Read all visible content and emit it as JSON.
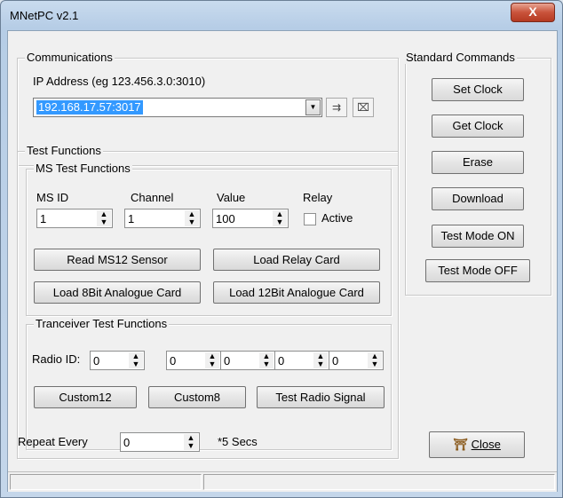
{
  "window": {
    "title": "MNetPC v2.1",
    "close_glyph": "X"
  },
  "communications": {
    "legend": "Communications",
    "ip_label": "IP Address (eg 123.456.3.0:3010)",
    "ip_value": "192.168.17.57:3017"
  },
  "test_functions": {
    "legend": "Test Functions",
    "ms": {
      "legend": "MS Test Functions",
      "ms_id_label": "MS ID",
      "channel_label": "Channel",
      "value_label": "Value",
      "relay_label": "Relay",
      "ms_id": "1",
      "channel": "1",
      "value": "100",
      "active_label": "Active",
      "buttons": {
        "read_ms12": "Read MS12 Sensor",
        "load_relay": "Load Relay Card",
        "load_8bit": "Load 8Bit Analogue Card",
        "load_12bit": "Load 12Bit Analogue Card"
      }
    },
    "tranceiver": {
      "legend": "Tranceiver Test Functions",
      "radio_id_label": "Radio ID:",
      "radio_ids": [
        "0",
        "0",
        "0",
        "0",
        "0"
      ],
      "buttons": {
        "custom12": "Custom12",
        "custom8": "Custom8",
        "test_radio": "Test Radio Signal"
      }
    }
  },
  "repeat": {
    "label": "Repeat Every",
    "value": "0",
    "suffix": "*5 Secs"
  },
  "standard_commands": {
    "legend": "Standard Commands",
    "buttons": [
      "Set Clock",
      "Get Clock",
      "Erase",
      "Download",
      "Test Mode ON",
      "Test Mode OFF"
    ]
  },
  "close_button": {
    "label": "Close",
    "icon": "door-exit-icon"
  }
}
